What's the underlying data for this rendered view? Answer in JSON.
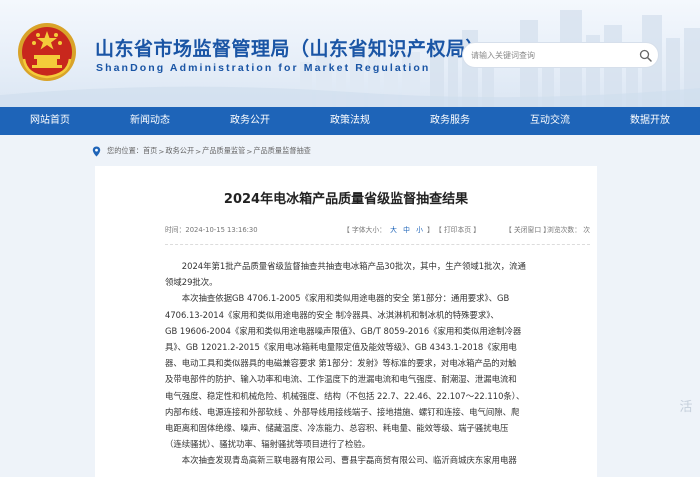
{
  "header": {
    "title": "山东省市场监督管理局（山东省知识产权局）",
    "subtitle": "ShanDong Administration for Market Regulation"
  },
  "search": {
    "placeholder": "请输入关键词查询"
  },
  "nav": {
    "items": [
      "网站首页",
      "新闻动态",
      "政务公开",
      "政策法规",
      "政务服务",
      "互动交流",
      "数据开放"
    ]
  },
  "breadcrumb": {
    "prefix": "您的位置：",
    "items": [
      "首页",
      "政务公开",
      "产品质量监管",
      "产品质量监督抽查"
    ],
    "separator": ">"
  },
  "article": {
    "title": "2024年电冰箱产品质量省级监督抽查结果",
    "time": "时间：2024-10-15 13:16:30",
    "font_size_prefix": "【 字体大小：",
    "font_large": "大",
    "font_medium": "中",
    "font_small": "小",
    "font_size_suffix": "】",
    "print": "【 打印本页 】",
    "close": "【 关闭窗口 】",
    "views": "浏览次数：  次",
    "paragraph1": [
      "2024年第1批产品质量省级监督抽查共抽查电冰箱产品30批次，其中，生产领域1批次，流通",
      "领域29批次。"
    ],
    "paragraph2": [
      "本次抽查依据GB 4706.1-2005《家用和类似用途电器的安全 第1部分：通用要求》、GB",
      "4706.13-2014《家用和类似用途电器的安全 制冷器具、冰淇淋机和制冰机的特殊要求》、",
      "GB 19606-2004《家用和类似用途电器噪声限值》、GB/T 8059-2016《家用和类似用途制冷器",
      "具》、GB 12021.2-2015《家用电冰箱耗电量限定值及能效等级》、GB 4343.1-2018《家用电",
      "器、电动工具和类似器具的电磁兼容要求 第1部分：发射》等标准的要求，对电冰箱产品的对触",
      "及带电部件的防护、输入功率和电流、工作温度下的泄漏电流和电气强度、耐潮湿、泄漏电流和",
      "电气强度、稳定性和机械危险、机械强度、结构（不包括 22.7、22.46、22.107～22.110条）、",
      "内部布线、电源连接和外部软线 、外部导线用接线端子、接地措施、螺钉和连接、电气间隙、爬",
      "电距离和固体绝缘、噪声、储藏温度、冷冻能力、总容积、耗电量、能效等级、端子骚扰电压",
      "（连续骚扰）、骚扰功率、辐射骚扰等项目进行了检验。"
    ],
    "paragraph3": [
      "本次抽查发现青岛高新三联电器有限公司、曹县宇磊商贸有限公司、临沂商城庆东家用电器"
    ]
  },
  "watermark": "活",
  "colors": {
    "brand_blue": "#1a55a5",
    "nav_blue": "#1e64b8"
  }
}
